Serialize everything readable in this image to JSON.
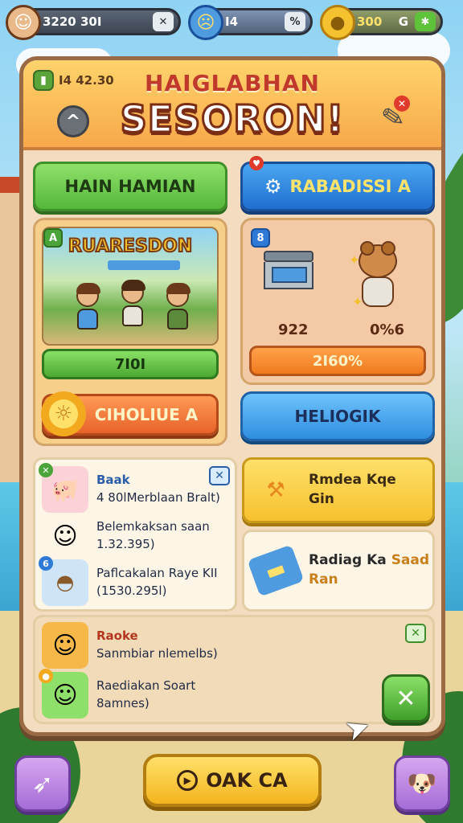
{
  "colors": {
    "panel_bg": "#f4dcc0",
    "header": "#f7a84a",
    "title_red": "#c0392b",
    "green": "#55b83a",
    "blue": "#1f6fd1",
    "orange": "#e8622a",
    "yellow": "#f3b51e",
    "purple": "#a46cd6"
  },
  "topbar": {
    "player": {
      "icon": "player-avatar-icon",
      "value": "3220 30I",
      "button": "✕"
    },
    "energy": {
      "icon": "face-coin-icon",
      "value": "I4",
      "button": "%"
    },
    "gold": {
      "icon": "gold-coin-icon",
      "value": "300",
      "extra": "G",
      "button": "✱"
    }
  },
  "header": {
    "badge": "I4 42.30",
    "subtitle": "HAIGLABHAN",
    "title": "SESORON!",
    "back_icon": "back-arrow-icon",
    "edit_icon": "pencil-icon"
  },
  "tabs": {
    "left": "HAIN HAMIAN",
    "right": "RABADISSI A",
    "right_icon": "gear-icon"
  },
  "card_left": {
    "badge": "A",
    "poster_title": "RUARESDON",
    "progress": "7I0I",
    "button": "CIHOLIUE A"
  },
  "card_right": {
    "badge": "8",
    "value_left": "922",
    "value_right": "0%6",
    "progress": "2I60%",
    "button": "HELIOGIK"
  },
  "list1": {
    "rows": [
      {
        "title": "Baak",
        "line2": "4 80lMerblaan Bralt)"
      },
      {
        "title": "Belemkaksan saan",
        "line2": "1.32.395)"
      },
      {
        "title": "Paflcakalan Raye KII",
        "line2": "(1530.295l)"
      }
    ]
  },
  "options": {
    "opt1_line1": "Rmdea Kqe",
    "opt1_line2": "Gin",
    "opt2_line1": "Radiag Ka",
    "opt2_accent": "Saad",
    "opt2_line2": "Ran"
  },
  "list2": {
    "rows": [
      {
        "title": "Raoke",
        "line2": "Sanmbiar nlemelbs)"
      },
      {
        "title": "Raediakan Soart",
        "line2": "8amnes)"
      }
    ]
  },
  "bottom": {
    "main_button": "OAK CA",
    "left_icon": "paper-plane-icon",
    "right_icon": "pet-icon"
  }
}
